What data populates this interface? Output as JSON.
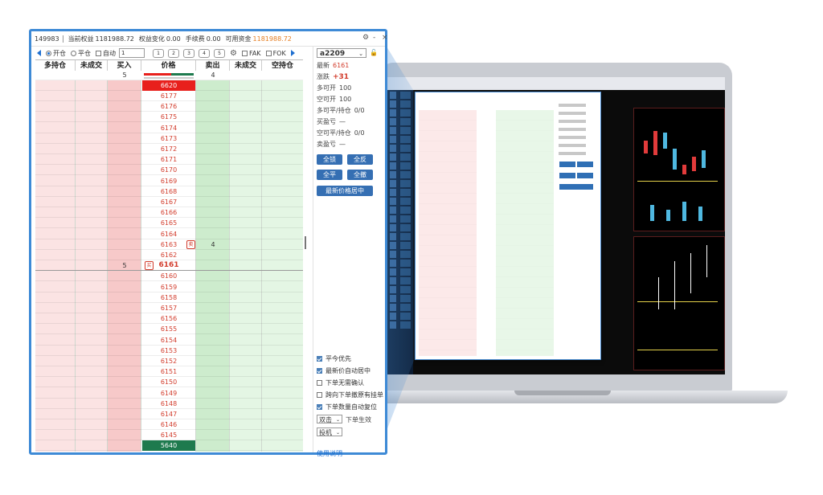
{
  "title_bar": {
    "account": "149983",
    "equity_label": "当前权益",
    "equity_value": "1181988.72",
    "pnl_label": "权益变化",
    "pnl_value": "0.00",
    "fee_label": "手续费",
    "fee_value": "0.00",
    "available_label": "可用资金",
    "available_value": "1181988.72",
    "controls": [
      "⚙",
      "-",
      "×"
    ]
  },
  "toolbar": {
    "open_label": "开仓",
    "close_label": "平仓",
    "auto_label": "自动",
    "quantity": "1",
    "presets": [
      "1",
      "2",
      "3",
      "4",
      "5"
    ],
    "fak_label": "FAK",
    "fok_label": "FOK"
  },
  "table": {
    "headers": [
      "多持仓",
      "未成交",
      "买入",
      "价格",
      "卖出",
      "未成交",
      "空持仓"
    ],
    "summary": {
      "buy": "5",
      "sell": "4"
    },
    "top_price": "6620",
    "bottom_price": "5640",
    "prices": [
      "6177",
      "6176",
      "6175",
      "6174",
      "6173",
      "6172",
      "6171",
      "6170",
      "6169",
      "6168",
      "6167",
      "6166",
      "6165",
      "6164",
      "6163",
      "6162",
      "6161",
      "6160",
      "6159",
      "6158",
      "6157",
      "6156",
      "6155",
      "6154",
      "6153",
      "6152",
      "6151",
      "6150",
      "6149",
      "6148",
      "6147",
      "6146",
      "6145"
    ],
    "sell_order": {
      "price": "6163",
      "qty": "4",
      "flag": "卖"
    },
    "buy_order": {
      "price": "6161",
      "qty": "5",
      "flag": "买"
    },
    "colors": {
      "buy_bg": "#fbe3e3",
      "sell_bg": "#e4f6e4",
      "price_text": "#d23c2c",
      "top_bg": "#e8201c",
      "bottom_bg": "#1e7a4e"
    }
  },
  "right_panel": {
    "contract": "a2209",
    "latest_label": "最新",
    "latest_value": "6161",
    "change_label": "涨跌",
    "change_value": "+31",
    "long_open_label": "多可开",
    "long_open_value": "100",
    "short_open_label": "空可开",
    "short_open_value": "100",
    "long_close_label": "多可平/持仓",
    "long_close_value": "0/0",
    "buy_no_label": "买盈亏",
    "buy_no_value": "—",
    "short_close_label": "空可平/持仓",
    "short_close_value": "0/0",
    "sell_no_label": "卖盈亏",
    "sell_no_value": "—",
    "buttons": {
      "lock_all": "全锁",
      "reverse_all": "全反",
      "close_all": "全平",
      "cancel_all": "全撤",
      "center": "最新价格居中"
    },
    "options": [
      "平今优先",
      "最新价自动居中",
      "下单无需确认",
      "跨向下单撤原有挂单",
      "下单数量自动复位"
    ],
    "options_checked": [
      true,
      true,
      false,
      false,
      true
    ],
    "click_mode": "双击",
    "click_effect": "下单生效",
    "hedge": "投机",
    "help_link": "使用说明"
  }
}
